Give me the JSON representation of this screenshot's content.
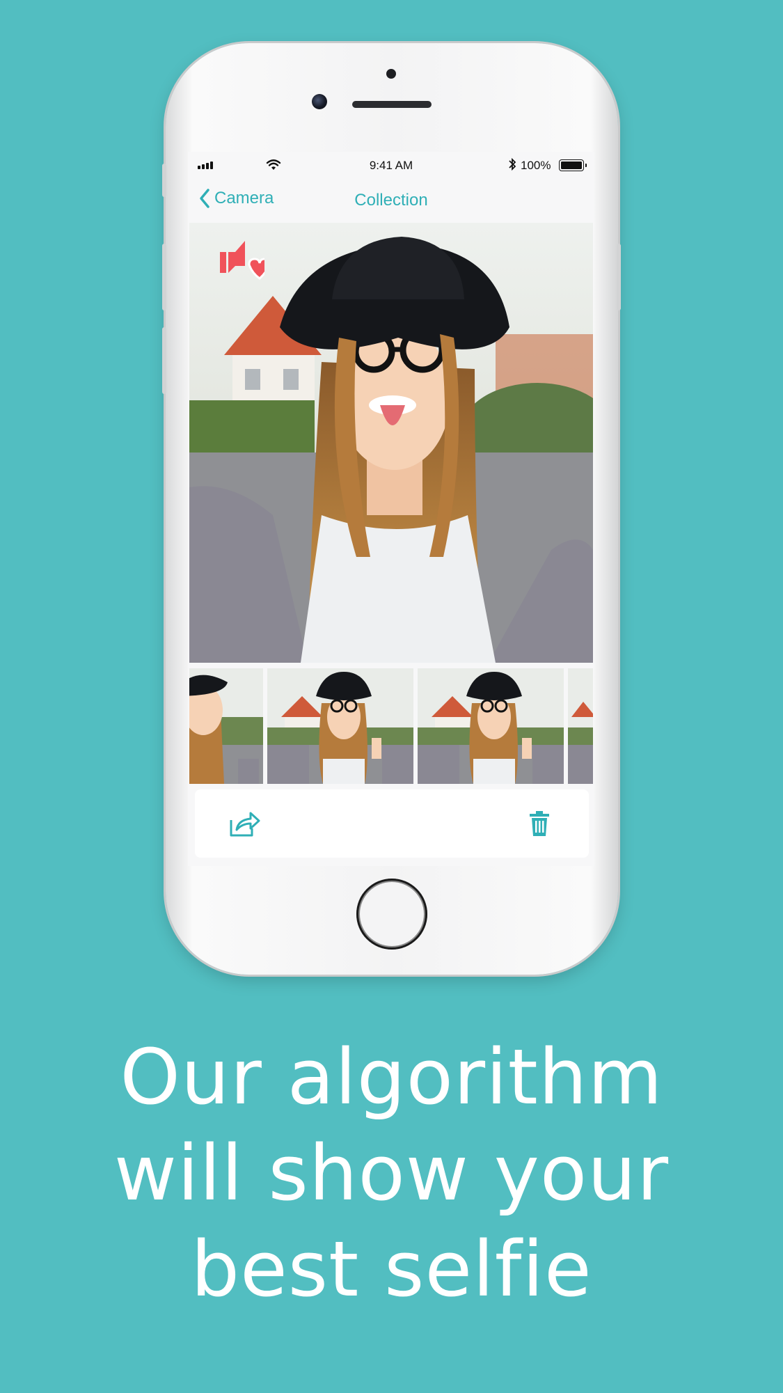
{
  "status_bar": {
    "time": "9:41 AM",
    "battery": "100%",
    "icons": [
      "signal-bars-icon",
      "wifi-icon",
      "bluetooth-icon",
      "battery-icon"
    ]
  },
  "nav": {
    "back_label": "Camera",
    "title": "Collection"
  },
  "photo": {
    "subject": "selfie-photo",
    "badge_icon": "rating-heart-icon"
  },
  "thumbnails": [
    {
      "name": "selfie-thumbnail-1"
    },
    {
      "name": "selfie-thumbnail-2"
    },
    {
      "name": "selfie-thumbnail-3"
    },
    {
      "name": "selfie-thumbnail-4"
    }
  ],
  "toolbar": {
    "share_icon": "share-icon",
    "delete_icon": "trash-icon"
  },
  "caption": {
    "lines": [
      "Our algorithm",
      "will show your",
      "best selfie"
    ]
  },
  "colors": {
    "background": "#52BEC1",
    "accent": "#2FAFB6",
    "badge": "#F0525A"
  }
}
